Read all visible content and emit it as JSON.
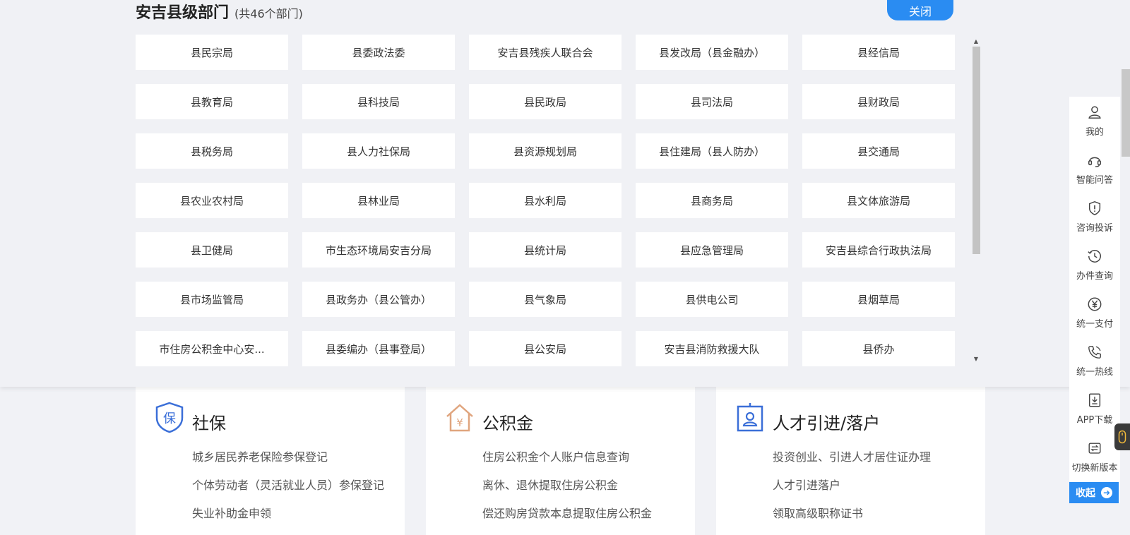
{
  "dept_panel": {
    "title": "安吉县级部门",
    "count": "(共46个部门)",
    "close_label": "关闭",
    "departments": [
      "县民宗局",
      "县委政法委",
      "安吉县残疾人联合会",
      "县发改局（县金融办）",
      "县经信局",
      "县教育局",
      "县科技局",
      "县民政局",
      "县司法局",
      "县财政局",
      "县税务局",
      "县人力社保局",
      "县资源规划局",
      "县住建局（县人防办）",
      "县交通局",
      "县农业农村局",
      "县林业局",
      "县水利局",
      "县商务局",
      "县文体旅游局",
      "县卫健局",
      "市生态环境局安吉分局",
      "县统计局",
      "县应急管理局",
      "安吉县综合行政执法局",
      "县市场监管局",
      "县政务办（县公管办）",
      "县气象局",
      "县供电公司",
      "县烟草局",
      "市住房公积金中心安...",
      "县委编办（县事登局）",
      "县公安局",
      "安吉县消防救援大队",
      "县侨办"
    ]
  },
  "cards": [
    {
      "title": "社保",
      "icon": "shield-bao-icon",
      "color": "#3b6fd8",
      "links": [
        "城乡居民养老保险参保登记",
        "个体劳动者（灵活就业人员）参保登记",
        "失业补助金申领"
      ]
    },
    {
      "title": "公积金",
      "icon": "house-yuan-icon",
      "color": "#e0a57e",
      "links": [
        "住房公积金个人账户信息查询",
        "离休、退休提取住房公积金",
        "偿还购房贷款本息提取住房公积金"
      ]
    },
    {
      "title": "人才引进/落户",
      "icon": "id-badge-icon",
      "color": "#3b6fd8",
      "links": [
        "投资创业、引进人才居住证办理",
        "人才引进落户",
        "领取高级职称证书"
      ]
    }
  ],
  "right_rail": {
    "items": [
      {
        "label": "我的",
        "icon": "user-icon"
      },
      {
        "label": "智能问答",
        "icon": "headset-icon"
      },
      {
        "label": "咨询投诉",
        "icon": "alert-shield-icon"
      },
      {
        "label": "办件查询",
        "icon": "history-icon"
      },
      {
        "label": "统一支付",
        "icon": "yuan-icon"
      },
      {
        "label": "统一热线",
        "icon": "phone-icon"
      },
      {
        "label": "APP下载",
        "icon": "download-icon"
      },
      {
        "label": "切换新版本",
        "icon": "switch-icon"
      }
    ],
    "collapse_label": "收起"
  }
}
